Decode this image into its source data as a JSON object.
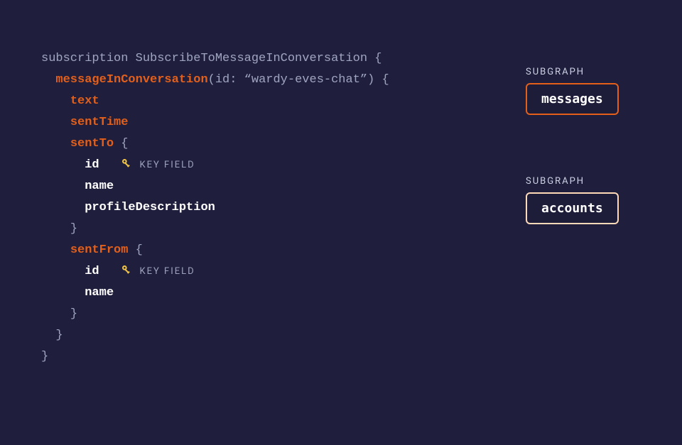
{
  "code": {
    "op_keyword": "subscription",
    "op_name": "SubscribeToMessageInConversation",
    "root_field": "messageInConversation",
    "root_arg_name": "id",
    "root_arg_value": "“wardy-eves-chat”",
    "fields": {
      "text": "text",
      "sentTime": "sentTime",
      "sentTo": "sentTo",
      "id": "id",
      "name": "name",
      "profileDescription": "profileDescription",
      "sentFrom": "sentFrom"
    },
    "key_field_label": "KEY FIELD"
  },
  "side": {
    "subgraph_label": "SUBGRAPH",
    "messages": "messages",
    "accounts": "accounts"
  }
}
